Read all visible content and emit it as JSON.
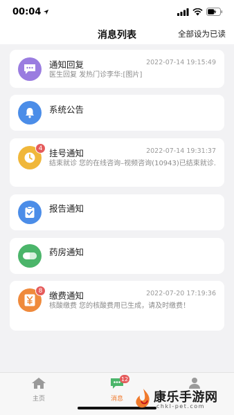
{
  "status_bar": {
    "time": "00:04"
  },
  "nav": {
    "title": "消息列表",
    "action": "全部设为已读"
  },
  "messages": [
    {
      "title": "通知回复",
      "time": "2022-07-14 19:15:49",
      "body": "医生回复 发热门诊李华:[图片]",
      "badge": "",
      "icon": "chat-bubble-icon",
      "color": "#9a7ce0"
    },
    {
      "title": "系统公告",
      "time": "",
      "body": "",
      "badge": "",
      "icon": "bell-icon",
      "color": "#4b8de8"
    },
    {
      "title": "挂号通知",
      "time": "2022-07-14 19:31:37",
      "body": "结束就诊 您的在线咨询–视频咨询(10943)已结束就诊.",
      "badge": "4",
      "icon": "clock-icon",
      "color": "#f0b73a"
    },
    {
      "title": "报告通知",
      "time": "",
      "body": "",
      "badge": "",
      "icon": "clipboard-icon",
      "color": "#4b8de8"
    },
    {
      "title": "药房通知",
      "time": "",
      "body": "",
      "badge": "",
      "icon": "pill-icon",
      "color": "#4bb56a"
    },
    {
      "title": "缴费通知",
      "time": "2022-07-20 17:19:36",
      "body": "核酸缴费 您的核酸费用已生成，请及时缴费！",
      "badge": "8",
      "icon": "yen-icon",
      "color": "#ef8a3c"
    }
  ],
  "tabs": [
    {
      "label": "主页",
      "icon": "home-icon",
      "active": false
    },
    {
      "label": "消息",
      "icon": "message-icon",
      "active": true,
      "badge": "12"
    },
    {
      "label": "",
      "icon": "user-icon",
      "active": false
    }
  ],
  "watermark": {
    "text": "康乐手游网",
    "sub": "chkl-pet.com"
  }
}
